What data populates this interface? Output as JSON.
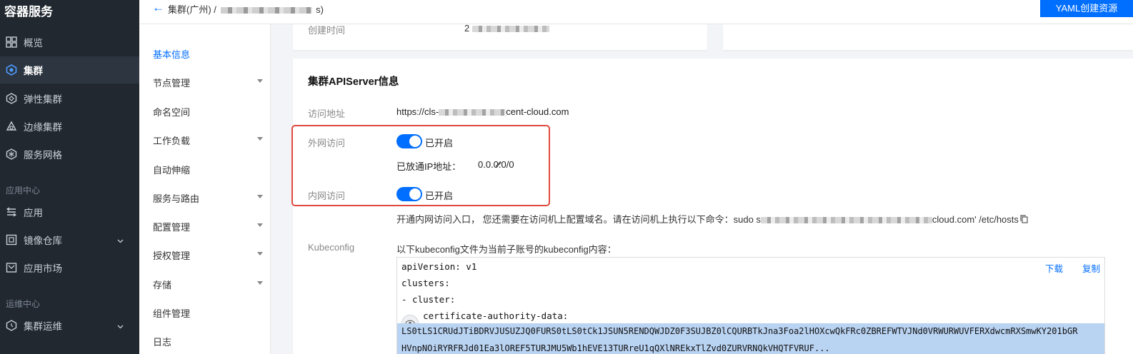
{
  "app": {
    "title": "容器服务"
  },
  "sidebar": {
    "items": [
      {
        "label": "概览"
      },
      {
        "label": "集群"
      },
      {
        "label": "弹性集群"
      },
      {
        "label": "边缘集群"
      },
      {
        "label": "服务网格"
      }
    ],
    "section_app": "应用中心",
    "app_items": [
      {
        "label": "应用"
      },
      {
        "label": "镜像仓库"
      },
      {
        "label": "应用市场"
      }
    ],
    "section_ops": "运维中心",
    "ops_items": [
      {
        "label": "集群运维"
      }
    ]
  },
  "header": {
    "breadcrumb_prefix": "集群(广州) /",
    "breadcrumb_suffix": "s)",
    "yaml_button": "YAML创建资源"
  },
  "subnav": {
    "items": [
      {
        "label": "基本信息",
        "active": true
      },
      {
        "label": "节点管理"
      },
      {
        "label": "命名空间"
      },
      {
        "label": "工作负载"
      },
      {
        "label": "自动伸缩"
      },
      {
        "label": "服务与路由"
      },
      {
        "label": "配置管理"
      },
      {
        "label": "授权管理"
      },
      {
        "label": "存储"
      },
      {
        "label": "组件管理"
      },
      {
        "label": "日志"
      }
    ]
  },
  "basic_card": {
    "create_time_label": "创建时间",
    "create_time_value_prefix": "2"
  },
  "apiserver": {
    "title": "集群APIServer信息",
    "access_label": "访问地址",
    "access_prefix": "https://cls-",
    "access_suffix": "cent-cloud.com",
    "public_label": "外网访问",
    "public_status": "已开启",
    "whitelist_label": "已放通IP地址：",
    "whitelist_value": "0.0.0.0/0",
    "private_label": "内网访问",
    "private_status": "已开启",
    "private_hint": "开通内网访问入口， 您还需要在访问机上配置域名。请在访问机上执行以下命令：sudo s",
    "private_hint_suffix": "cloud.com' /etc/hosts",
    "kubeconfig_label": "Kubeconfig",
    "kubeconfig_desc": "以下kubeconfig文件为当前子账号的kubeconfig内容：",
    "download_label": "下载",
    "copy_label": "复制",
    "kubeconfig_lines": [
      "apiVersion: v1",
      "clusters:",
      "- cluster:",
      "    certificate-authority-data:"
    ],
    "cert_line_1": "LS0tLS1CRUdJTiBDRVJUSUZJQ0FURS0tLS0tCk1JSUN5RENDQWJDZ0F3SUJBZ0lCQURBTkJna3Foa2lHOXcwQkFRc0ZBREFWTVJNd0VRWURWUVFERXdwcmRXSmwKY201bGR",
    "cert_line_2": "HVnpNOiRYRFRJd01Ea3lOREF5TURJMU5Wb1hEVE13TURreU1qQXlNREkxTlZvd0ZURVRNQkVHQTFVRUF..."
  },
  "colors": {
    "accent": "#006eff",
    "sidebar_bg": "#212830",
    "highlight_border": "#e0483e"
  }
}
